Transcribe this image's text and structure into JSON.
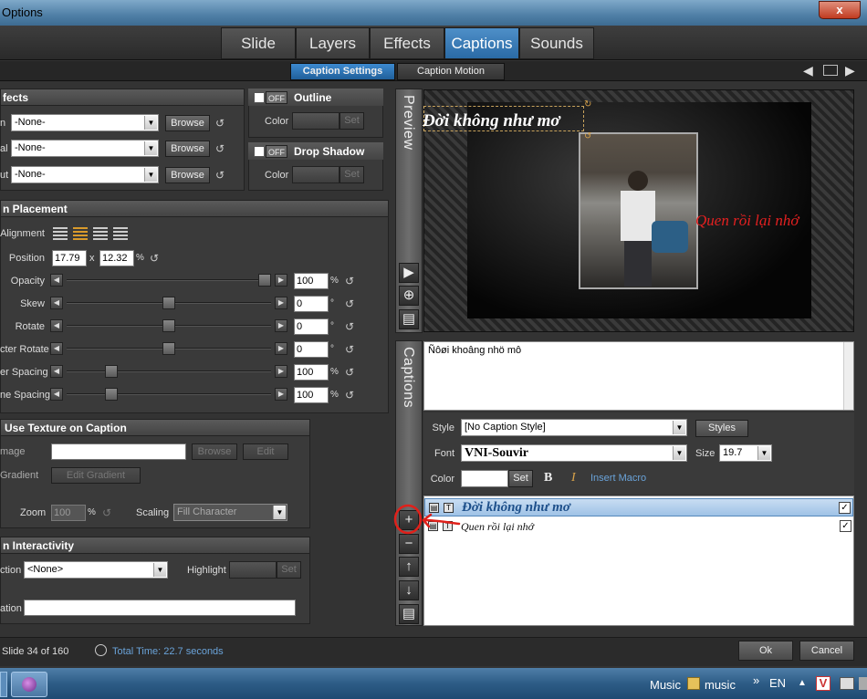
{
  "window": {
    "title": "Options",
    "close_label": "x"
  },
  "tabs": [
    {
      "label": "Slide"
    },
    {
      "label": "Layers"
    },
    {
      "label": "Effects"
    },
    {
      "label": "Captions",
      "active": true
    },
    {
      "label": "Sounds"
    }
  ],
  "subtabs": [
    {
      "label": "Caption Settings",
      "active": true
    },
    {
      "label": "Caption Motion"
    }
  ],
  "effects": {
    "header": "fects",
    "rows": [
      {
        "label": "n",
        "value": "-None-",
        "button": "Browse"
      },
      {
        "label": "al",
        "value": "-None-",
        "button": "Browse"
      },
      {
        "label": "ut",
        "value": "-None-",
        "button": "Browse"
      }
    ]
  },
  "outline": {
    "header": "Outline",
    "toggle": "OFF",
    "color_label": "Color",
    "set_label": "Set"
  },
  "drop_shadow": {
    "header": "Drop Shadow",
    "toggle": "OFF",
    "color_label": "Color",
    "set_label": "Set"
  },
  "placement": {
    "header": "n Placement",
    "alignment_label": "Alignment",
    "position_label": "Position",
    "position_x": "17.79",
    "position_sep": "x",
    "position_y": "12.32",
    "position_unit": "%",
    "sliders": [
      {
        "label": "Opacity",
        "value": "100",
        "unit": "%",
        "level": 1.0
      },
      {
        "label": "Skew",
        "value": "0",
        "unit": "°",
        "level": 0.5
      },
      {
        "label": "Rotate",
        "value": "0",
        "unit": "°",
        "level": 0.5
      },
      {
        "label": "cter Rotate",
        "value": "0",
        "unit": "°",
        "level": 0.5
      },
      {
        "label": "er Spacing",
        "value": "100",
        "unit": "%",
        "level": 0.2
      },
      {
        "label": "ne Spacing",
        "value": "100",
        "unit": "%",
        "level": 0.2
      }
    ]
  },
  "texture": {
    "header": "Use Texture on Caption",
    "image_label": "mage",
    "browse_label": "Browse",
    "edit_label": "Edit",
    "gradient_label": "Gradient",
    "edit_gradient_label": "Edit Gradient",
    "zoom_label": "Zoom",
    "zoom_value": "100",
    "zoom_unit": "%",
    "scaling_label": "Scaling",
    "scaling_value": "Fill Character"
  },
  "interactivity": {
    "header": "n Interactivity",
    "action_label": "ction",
    "action_value": "<None>",
    "highlight_label": "Highlight",
    "set_label": "Set",
    "location_label": "ation",
    "location_value": ""
  },
  "preview": {
    "label": "Preview",
    "caption1": "Đời không như mơ",
    "caption2": "Quen rồi lại nhớ"
  },
  "captions_panel": {
    "label": "Captions",
    "text_value": "Ñôøi khoâng nhö mô",
    "style_label": "Style",
    "style_value": "[No Caption Style]",
    "styles_button": "Styles",
    "font_label": "Font",
    "font_value": "VNI-Souvir",
    "size_label": "Size",
    "size_value": "19.7",
    "color_label": "Color",
    "set_label": "Set",
    "bold_label": "B",
    "italic_label": "I",
    "insert_macro": "Insert Macro",
    "list": [
      {
        "text": "Đời không như mơ",
        "checked": true,
        "selected": true
      },
      {
        "text": "Quen rồi lại nhớ",
        "checked": true,
        "selected": false
      }
    ]
  },
  "status": {
    "slide_info": "Slide 34 of 160",
    "total_time": "Total Time: 22.7 seconds",
    "ok_label": "Ok",
    "cancel_label": "Cancel"
  },
  "taskbar": {
    "music_label": "Music",
    "folder_label": "music",
    "overflow": "»",
    "lang": "EN"
  },
  "colors": {
    "accent": "#2a6aa5",
    "caption_red": "#e32020",
    "annotation_red": "#e0201a"
  }
}
